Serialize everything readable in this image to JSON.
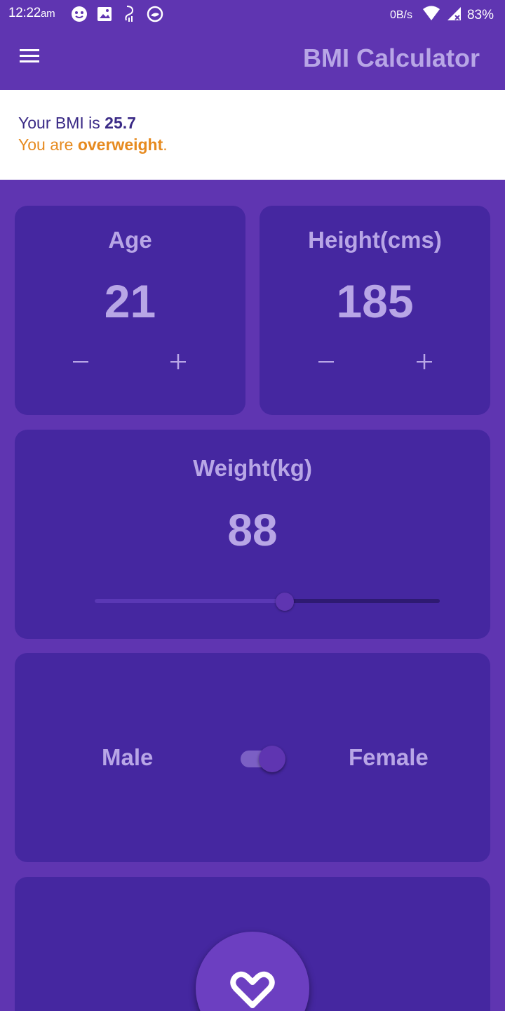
{
  "status_bar": {
    "time": "12:22",
    "ampm": "am",
    "network_speed": "0B/s",
    "battery": "83%",
    "icons": [
      "face-icon",
      "image-icon",
      "signal-notification-icon",
      "circle-app-icon",
      "wifi-icon",
      "cell-signal-icon",
      "battery-icon"
    ]
  },
  "app_bar": {
    "title": "BMI Calculator",
    "menu_icon": "menu-icon"
  },
  "result": {
    "bmi_prefix": "Your BMI is ",
    "bmi_value": "25.7",
    "status_prefix": "You are ",
    "status_value": "overweight",
    "status_suffix": ".",
    "colors": {
      "bmi": "#3a2a86",
      "status": "#e68a1f"
    }
  },
  "age": {
    "label": "Age",
    "value": "21",
    "decrement_icon": "minus-icon",
    "increment_icon": "plus-icon"
  },
  "height": {
    "label": "Height(cms)",
    "value": "185",
    "decrement_icon": "minus-icon",
    "increment_icon": "plus-icon"
  },
  "weight": {
    "label": "Weight(kg)",
    "value": "88",
    "slider_fraction": 0.55
  },
  "gender": {
    "male_label": "Male",
    "female_label": "Female",
    "switch_on": true
  },
  "calculate": {
    "icon": "heart-icon"
  },
  "colors": {
    "background": "#5f35b1",
    "card": "#4527a0",
    "text_accent": "#b8a6e6",
    "white": "#ffffff"
  }
}
